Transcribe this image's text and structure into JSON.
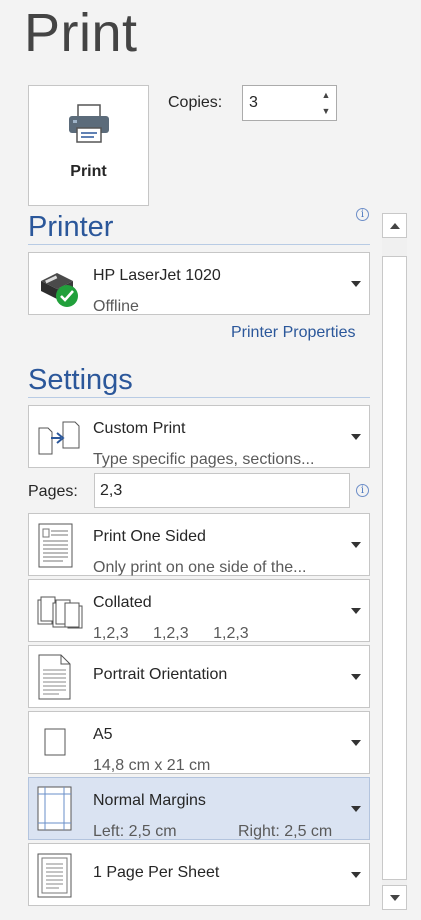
{
  "page_title": "Print",
  "print_button": {
    "label": "Print",
    "icon": "printer-icon"
  },
  "copies": {
    "label": "Copies:",
    "value": "3"
  },
  "printer": {
    "section_title": "Printer",
    "name": "HP LaserJet 1020",
    "status": "Offline",
    "properties_link": "Printer Properties"
  },
  "settings": {
    "section_title": "Settings",
    "print_range": {
      "title": "Custom Print",
      "subtitle": "Type specific pages, sections..."
    },
    "pages": {
      "label": "Pages:",
      "value": "2,3"
    },
    "sides": {
      "title": "Print One Sided",
      "subtitle": "Only print on one side of the..."
    },
    "collation": {
      "title": "Collated",
      "sequence": [
        "1,2,3",
        "1,2,3",
        "1,2,3"
      ]
    },
    "orientation": {
      "title": "Portrait Orientation"
    },
    "paper_size": {
      "title": "A5",
      "subtitle": "14,8 cm x 21 cm"
    },
    "margins": {
      "title": "Normal Margins",
      "left": "Left:  2,5 cm",
      "right": "Right:  2,5 cm"
    },
    "pages_per_sheet": {
      "title": "1 Page Per Sheet"
    }
  },
  "colors": {
    "accent": "#2b579a",
    "selected_bg": "#dae3f2",
    "status_ok": "#21a03b"
  }
}
